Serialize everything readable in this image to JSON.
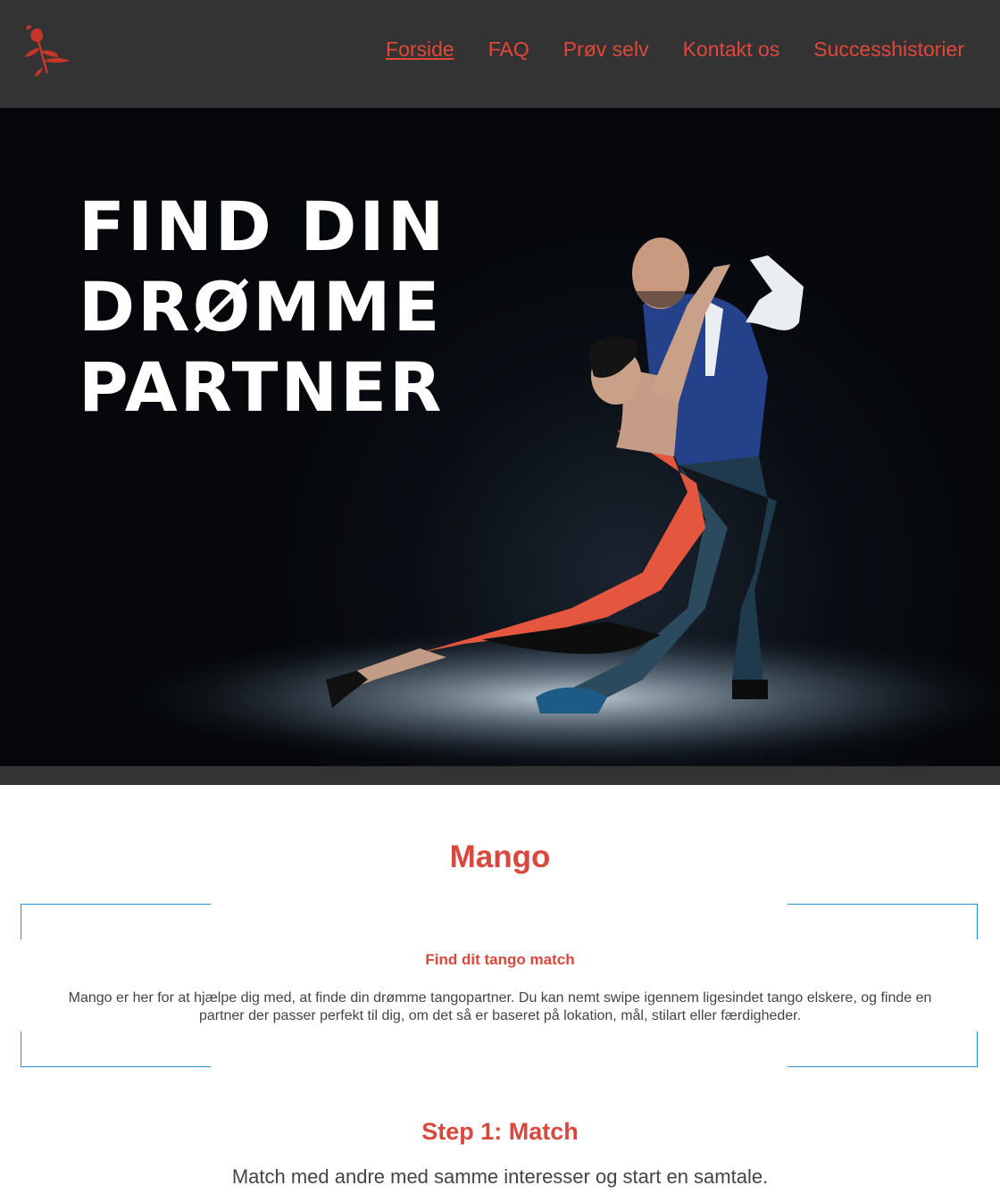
{
  "header": {
    "logo_icon": "rose-icon",
    "nav": [
      {
        "label": "Forside",
        "active": true
      },
      {
        "label": "FAQ",
        "active": false
      },
      {
        "label": "Prøv selv",
        "active": false
      },
      {
        "label": "Kontakt os",
        "active": false
      },
      {
        "label": "Successhistorier",
        "active": false
      }
    ]
  },
  "hero": {
    "title_lines": [
      "FIND DIN",
      "DRØMME",
      "PARTNER"
    ]
  },
  "main": {
    "site_title": "Mango",
    "card": {
      "heading": "Find dit tango match",
      "text": "Mango er her for at hjælpe dig med, at finde din drømme tangopartner. Du kan nemt swipe igennem ligesindet tango elskere, og finde en partner der passer perfekt til dig, om det så er baseret på lokation, mål, stilart eller færdigheder."
    },
    "step": {
      "title": "Step 1: Match",
      "text": "Match med andre med samme interesser og start en samtale."
    }
  },
  "colors": {
    "accent": "#d9483c",
    "header_bg": "#333333",
    "frame_border": "#2b8fd6"
  }
}
